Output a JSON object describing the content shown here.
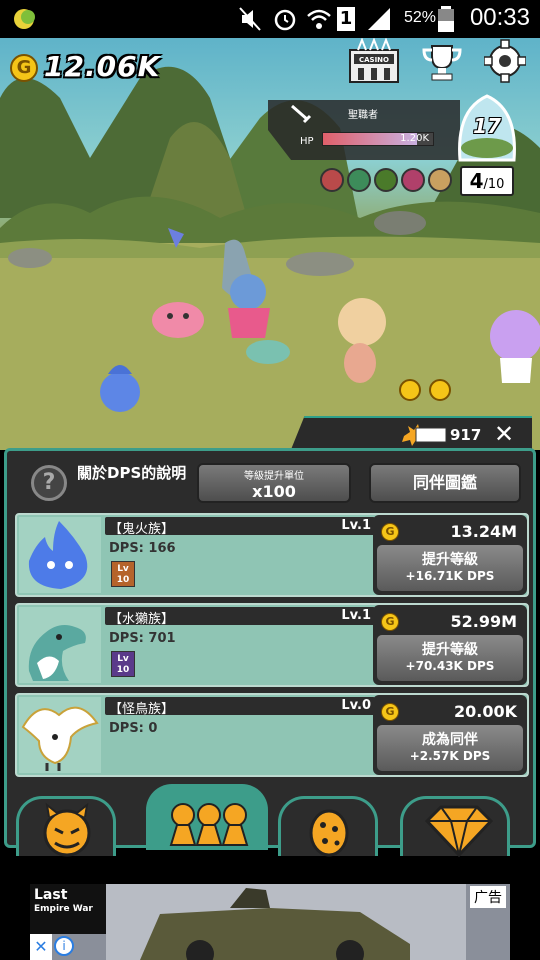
{
  "status_bar": {
    "battery_pct": "52%",
    "time": "00:33",
    "sim_label": "1"
  },
  "hud": {
    "coins": "12.06K",
    "casino_label": "CASINO",
    "boss_name": "聖職者",
    "hp_label": "HP",
    "hp_value": "1.20K",
    "hp_fraction": 0.85,
    "stage_number": "17",
    "wave_current": "4",
    "wave_total": "/10",
    "kill_count": "917",
    "close_symbol": "✕"
  },
  "panel": {
    "help_symbol": "?",
    "help_text": "關於DPS的說明",
    "level_unit_title": "等級提升單位",
    "level_unit_value": "x100",
    "codex_button": "同伴圖鑑"
  },
  "companions": [
    {
      "name": "【鬼火族】",
      "level": "Lv.1",
      "dps": "DPS: 166",
      "badge_line1": "Lv",
      "badge_line2": "10",
      "badge_color": "#b5642b",
      "cost": "13.24M",
      "action": "提升等級",
      "gain": "+16.71K DPS"
    },
    {
      "name": "【水獺族】",
      "level": "Lv.1",
      "dps": "DPS: 701",
      "badge_line1": "Lv",
      "badge_line2": "10",
      "badge_color": "#5a3a8a",
      "cost": "52.99M",
      "action": "提升等級",
      "gain": "+70.43K DPS"
    },
    {
      "name": "【怪鳥族】",
      "level": "Lv.0",
      "dps": "DPS: 0",
      "badge_line1": "",
      "badge_line2": "",
      "badge_color": "",
      "cost": "20.00K",
      "action": "成為同伴",
      "gain": "+2.57K DPS"
    }
  ],
  "coin_symbol": "G",
  "ad": {
    "label": "广告",
    "logo_title": "Last",
    "logo_sub": "Empire War",
    "close": "✕",
    "info": "i"
  },
  "colors": {
    "accent": "#3d9d8a",
    "panel": "#2c2c2c",
    "row": "#8fc5b4",
    "coin": "#f5c518"
  }
}
